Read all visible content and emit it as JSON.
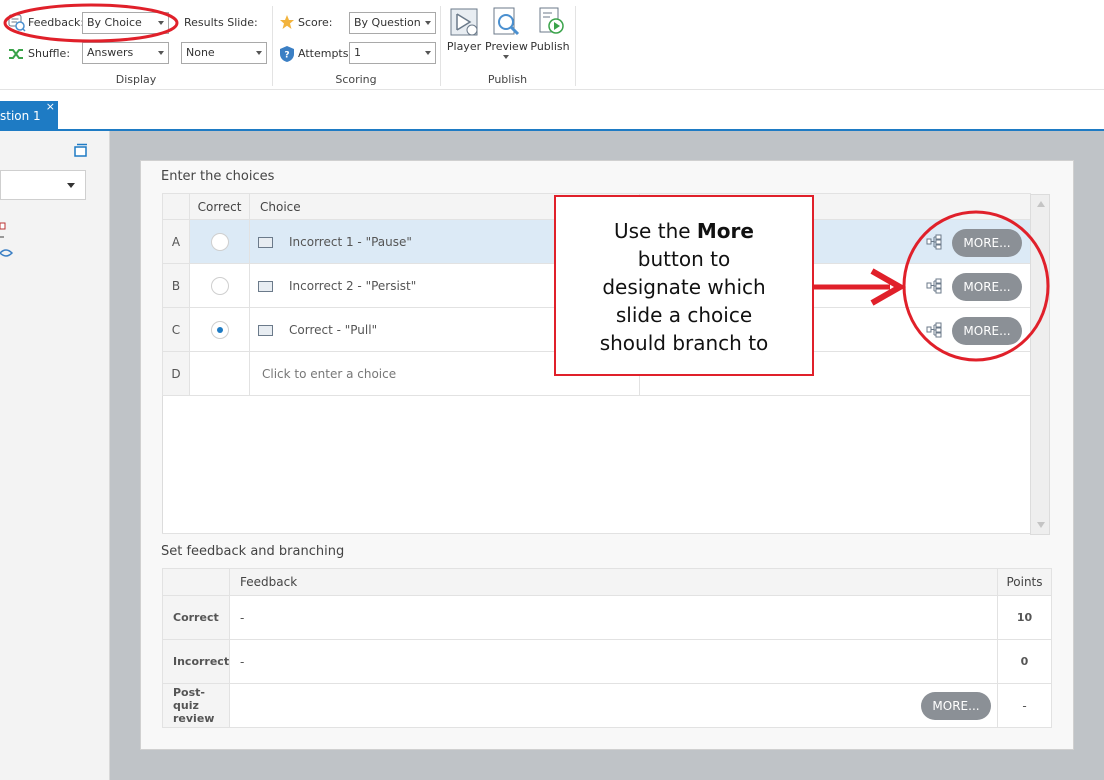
{
  "ribbon": {
    "feedback_label": "Feedback:",
    "feedback_value": "By Choice",
    "results_slide_label": "Results Slide:",
    "results_slide_value": "None",
    "shuffle_label": "Shuffle:",
    "shuffle_value": "Answers",
    "score_label": "Score:",
    "score_value": "By Question",
    "attempts_label": "Attempts:",
    "attempts_value": "1",
    "display_group": "Display",
    "scoring_group": "Scoring",
    "publish_group": "Publish",
    "player_label": "Player",
    "preview_label": "Preview",
    "publish_label": "Publish"
  },
  "tab": {
    "label": "stion 1",
    "close": "×"
  },
  "choices_section": {
    "title": "Enter the choices",
    "col_correct": "Correct",
    "col_choice": "Choice",
    "rows": [
      {
        "letter": "A",
        "text": "Incorrect 1 - \"Pause\"",
        "selected": false
      },
      {
        "letter": "B",
        "text": "Incorrect 2 - \"Persist\"",
        "selected": false
      },
      {
        "letter": "C",
        "text": "Correct - \"Pull\"",
        "selected": true
      },
      {
        "letter": "D",
        "placeholder": "Click to enter a choice"
      }
    ],
    "more_label": "MORE..."
  },
  "feedback_section": {
    "title": "Set feedback and branching",
    "col_feedback": "Feedback",
    "col_points": "Points",
    "rows": [
      {
        "label": "Correct",
        "feedback": "-",
        "points": "10"
      },
      {
        "label": "Incorrect",
        "feedback": "-",
        "points": "0"
      },
      {
        "label": "Post-quiz review",
        "feedback": "",
        "points": "-"
      }
    ],
    "more_label": "MORE..."
  },
  "callout": {
    "line_pre": "Use the ",
    "line_bold": "More",
    "line_rest": "button to designate which slide a choice should branch to"
  },
  "colors": {
    "accent": "#1e7bc4",
    "annotation": "#e0202a",
    "more_button": "#8b9096"
  }
}
